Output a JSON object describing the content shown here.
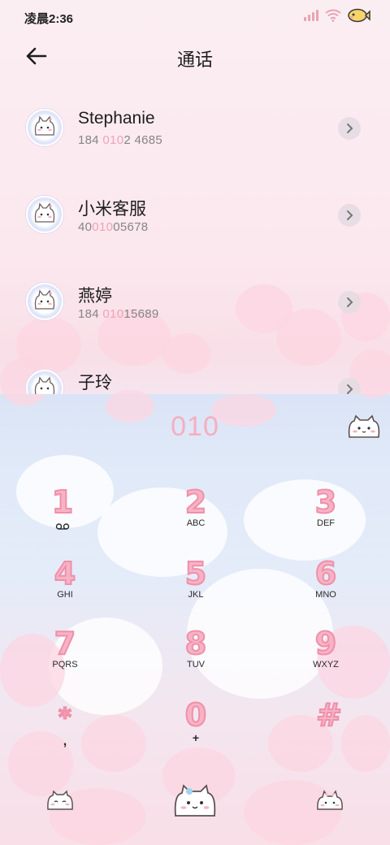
{
  "status_bar": {
    "time": "凌晨2:36"
  },
  "header": {
    "title": "通话"
  },
  "contacts": [
    {
      "name": "Stephanie",
      "num_pre": "184 ",
      "num_hl": "010",
      "num_post": "2 4685"
    },
    {
      "name": "小米客服",
      "num_pre": "40",
      "num_hl": "010",
      "num_post": "05678"
    },
    {
      "name": "燕婷",
      "num_pre": "184 ",
      "num_hl": "010",
      "num_post": "15689"
    },
    {
      "name": "子玲",
      "num_pre": "",
      "num_hl": "",
      "num_post": ""
    }
  ],
  "dialer": {
    "input": "010",
    "keys": [
      {
        "digit": "1",
        "letters": ""
      },
      {
        "digit": "2",
        "letters": "ABC"
      },
      {
        "digit": "3",
        "letters": "DEF"
      },
      {
        "digit": "4",
        "letters": "GHI"
      },
      {
        "digit": "5",
        "letters": "JKL"
      },
      {
        "digit": "6",
        "letters": "MNO"
      },
      {
        "digit": "7",
        "letters": "PQRS"
      },
      {
        "digit": "8",
        "letters": "TUV"
      },
      {
        "digit": "9",
        "letters": "WXYZ"
      },
      {
        "digit": "*",
        "letters": ","
      },
      {
        "digit": "0",
        "letters": "+"
      },
      {
        "digit": "#",
        "letters": ""
      }
    ]
  },
  "icons": {
    "back": "back-arrow-icon",
    "detail": "chevron-right-icon",
    "voicemail": "voicemail-icon",
    "call": "cat-call-icon"
  },
  "colors": {
    "accent_pink": "#f6aec0",
    "highlight": "#f0a2b8",
    "text": "#1e1e1e"
  }
}
